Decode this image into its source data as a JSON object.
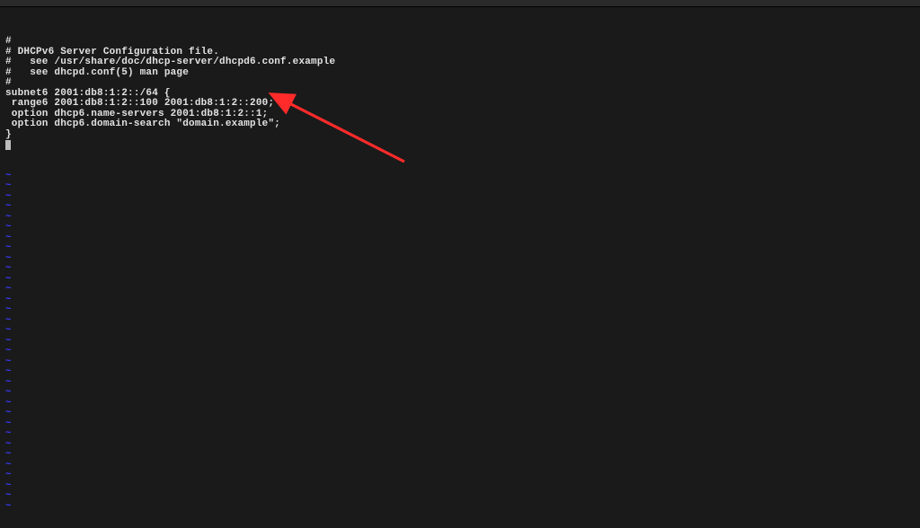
{
  "titlebar": {
    "title": ""
  },
  "file": {
    "lines": [
      "#",
      "# DHCPv6 Server Configuration file.",
      "#   see /usr/share/doc/dhcp-server/dhcpd6.conf.example",
      "#   see dhcpd.conf(5) man page",
      "#",
      "subnet6 2001:db8:1:2::/64 {",
      " range6 2001:db8:1:2::100 2001:db8:1:2::200;",
      " option dhcp6.name-servers 2001:db8:1:2::1;",
      " option dhcp6.domain-search \"domain.example\";",
      "}"
    ],
    "tilde_rows": 33,
    "tilde_char": "~"
  },
  "annotation": {
    "type": "arrow",
    "color": "#ff2b2b"
  }
}
